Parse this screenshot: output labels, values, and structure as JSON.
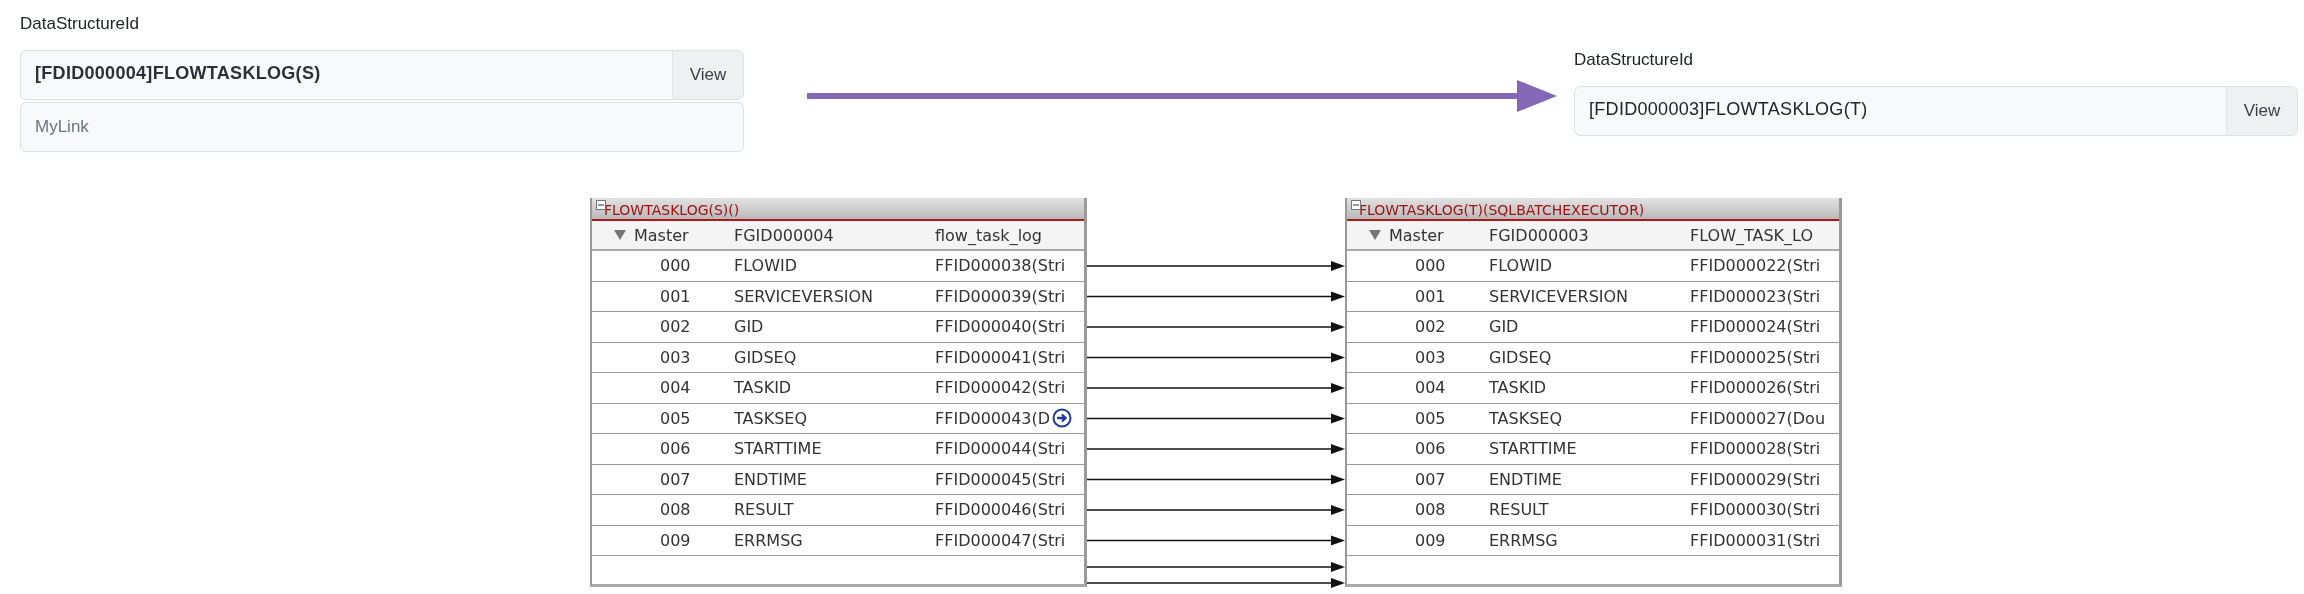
{
  "source": {
    "label": "DataStructureId",
    "value": "[FDID000004]FLOWTASKLOG(S)",
    "button": "View",
    "link_placeholder": "MyLink"
  },
  "target": {
    "label": "DataStructureId",
    "value": "[FDID000003]FLOWTASKLOG(T)",
    "button": "View"
  },
  "tables": [
    {
      "title": "FLOWTASKLOG(S)()",
      "master": {
        "label": "Master",
        "id": "FGID000004",
        "name": "flow_task_log",
        "expanded": true
      },
      "rows": [
        {
          "index": "000",
          "name": "FLOWID",
          "type": "FFID000038(Stri",
          "linked": false
        },
        {
          "index": "001",
          "name": "SERVICEVERSION",
          "type": "FFID000039(Stri",
          "linked": false
        },
        {
          "index": "002",
          "name": "GID",
          "type": "FFID000040(Stri",
          "linked": false
        },
        {
          "index": "003",
          "name": "GIDSEQ",
          "type": "FFID000041(Stri",
          "linked": false
        },
        {
          "index": "004",
          "name": "TASKID",
          "type": "FFID000042(Stri",
          "linked": false
        },
        {
          "index": "005",
          "name": "TASKSEQ",
          "type": "FFID000043(D",
          "linked": true
        },
        {
          "index": "006",
          "name": "STARTTIME",
          "type": "FFID000044(Stri",
          "linked": false
        },
        {
          "index": "007",
          "name": "ENDTIME",
          "type": "FFID000045(Stri",
          "linked": false
        },
        {
          "index": "008",
          "name": "RESULT",
          "type": "FFID000046(Stri",
          "linked": false
        },
        {
          "index": "009",
          "name": "ERRMSG",
          "type": "FFID000047(Stri",
          "linked": false
        }
      ]
    },
    {
      "title": "FLOWTASKLOG(T)(SQLBATCHEXECUTOR)",
      "master": {
        "label": "Master",
        "id": "FGID000003",
        "name": "FLOW_TASK_LO",
        "expanded": true
      },
      "rows": [
        {
          "index": "000",
          "name": "FLOWID",
          "type": "FFID000022(Stri",
          "linked": false
        },
        {
          "index": "001",
          "name": "SERVICEVERSION",
          "type": "FFID000023(Stri",
          "linked": false
        },
        {
          "index": "002",
          "name": "GID",
          "type": "FFID000024(Stri",
          "linked": false
        },
        {
          "index": "003",
          "name": "GIDSEQ",
          "type": "FFID000025(Stri",
          "linked": false
        },
        {
          "index": "004",
          "name": "TASKID",
          "type": "FFID000026(Stri",
          "linked": false
        },
        {
          "index": "005",
          "name": "TASKSEQ",
          "type": "FFID000027(Dou",
          "linked": false
        },
        {
          "index": "006",
          "name": "STARTTIME",
          "type": "FFID000028(Stri",
          "linked": false
        },
        {
          "index": "007",
          "name": "ENDTIME",
          "type": "FFID000029(Stri",
          "linked": false
        },
        {
          "index": "008",
          "name": "RESULT",
          "type": "FFID000030(Stri",
          "linked": false
        },
        {
          "index": "009",
          "name": "ERRMSG",
          "type": "FFID000031(Stri",
          "linked": false
        }
      ]
    }
  ]
}
